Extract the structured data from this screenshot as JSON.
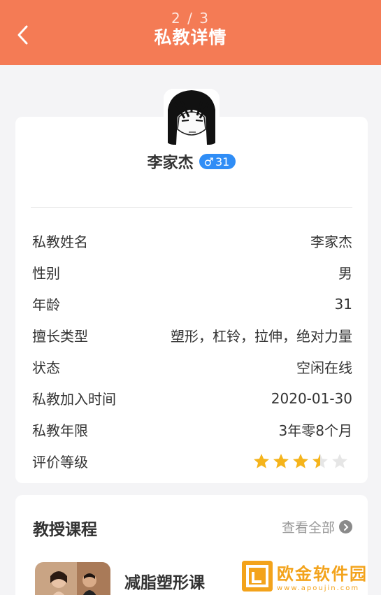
{
  "header": {
    "pager": "2 / 3",
    "title": "私教详情"
  },
  "profile": {
    "name": "李家杰",
    "gender_symbol": "♂",
    "age_badge": "31"
  },
  "details": [
    {
      "label": "私教姓名",
      "value": "李家杰"
    },
    {
      "label": "性别",
      "value": "男"
    },
    {
      "label": "年龄",
      "value": "31"
    },
    {
      "label": "擅长类型",
      "value": "塑形，杠铃，拉伸，绝对力量"
    },
    {
      "label": "状态",
      "value": "空闲在线"
    },
    {
      "label": "私教加入时间",
      "value": "2020-01-30"
    },
    {
      "label": "私教年限",
      "value": "3年零8个月"
    },
    {
      "label": "评价等级",
      "value": ""
    }
  ],
  "rating": {
    "value": 3.5,
    "max": 5
  },
  "courses": {
    "section_title": "教授课程",
    "view_all": "查看全部",
    "items": [
      {
        "name": "减脂塑形课"
      }
    ]
  },
  "watermark": {
    "title": "欧金软件园",
    "url": "www.apoujin.com"
  },
  "colors": {
    "header": "#f47b55",
    "badge": "#2f8df6",
    "star": "#f5b41b",
    "star_empty": "#e6e6e6"
  }
}
